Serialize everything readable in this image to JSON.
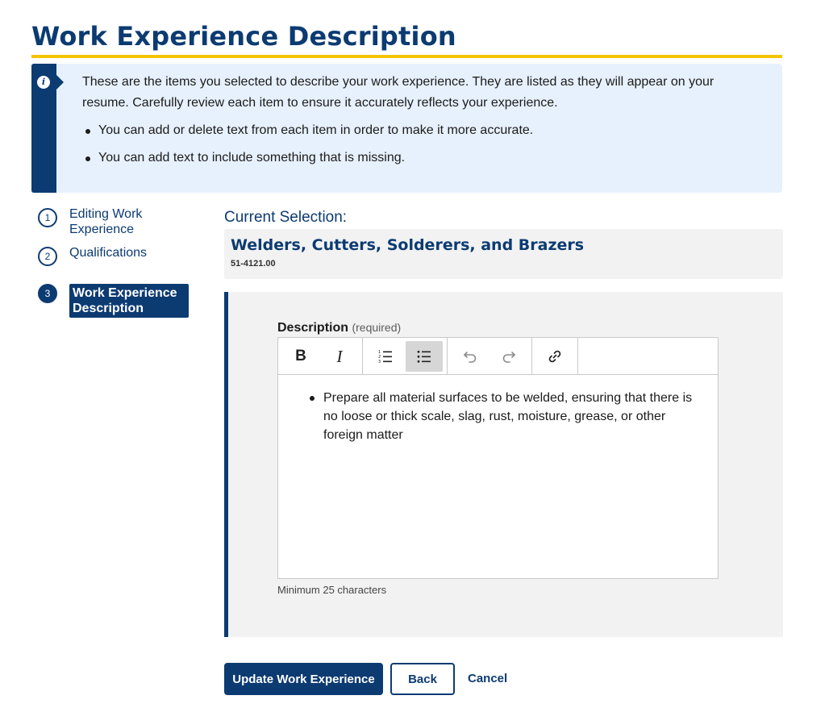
{
  "page": {
    "title": "Work Experience Description"
  },
  "alert": {
    "intro": "These are the items you selected to describe your work experience. They are listed as they will appear on your resume. Carefully review each item to ensure it accurately reflects your experience.",
    "bullets": [
      "You can add or delete text from each item in order to make it more accurate.",
      "You can add text to include something that is missing."
    ]
  },
  "steps": [
    {
      "number": "1",
      "label": "Editing Work Experience"
    },
    {
      "number": "2",
      "label": "Qualifications"
    },
    {
      "number": "3",
      "label": "Work Experience Description"
    }
  ],
  "selection": {
    "heading": "Current Selection:",
    "occupation": "Welders, Cutters, Solderers, and Brazers",
    "code": "51-4121.00"
  },
  "description": {
    "label": "Description",
    "required": "(required)",
    "items": [
      "Prepare all material surfaces to be welded, ensuring that there is no loose or thick scale, slag, rust, moisture, grease, or other foreign matter"
    ],
    "hint": "Minimum 25 characters"
  },
  "toolbar": {
    "bold": "B",
    "italic": "I",
    "icons": [
      "bold-icon",
      "italic-icon",
      "numbered-list-icon",
      "bulleted-list-icon",
      "undo-icon",
      "redo-icon",
      "link-icon"
    ]
  },
  "actions": {
    "update": "Update Work Experience",
    "back": "Back",
    "cancel": "Cancel"
  },
  "colors": {
    "brand": "#0c3b72",
    "accent": "#f5c400",
    "alert_bg": "#e7f1fd",
    "panel_bg": "#f2f2f2"
  }
}
